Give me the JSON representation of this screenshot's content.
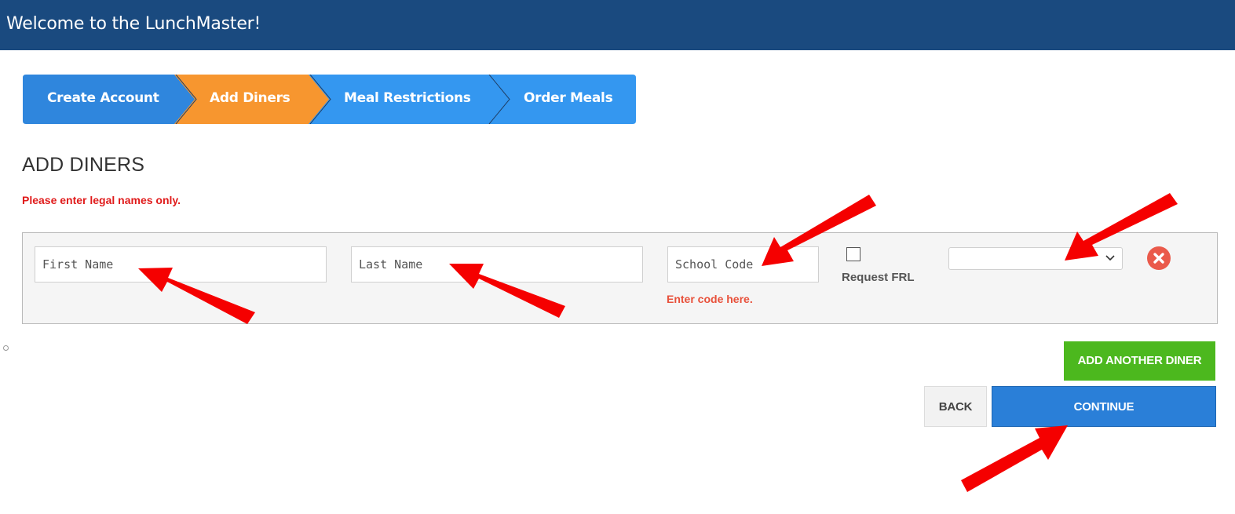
{
  "header": {
    "title": "Welcome to the LunchMaster!"
  },
  "steps": [
    {
      "label": "Create Account",
      "state": "complete"
    },
    {
      "label": "Add Diners",
      "state": "active"
    },
    {
      "label": "Meal Restrictions",
      "state": "upcoming"
    },
    {
      "label": "Order Meals",
      "state": "upcoming"
    }
  ],
  "colors": {
    "header": "#1a4a7f",
    "step_complete": "#2f86dd",
    "step_active": "#f7962f",
    "step_upcoming": "#3497f0",
    "warning": "#e01b1b",
    "add_button": "#4cb81e",
    "continue_button": "#2a7fd8",
    "annotation_arrow": "#f50000"
  },
  "main": {
    "heading": "ADD DINERS",
    "notice": "Please enter legal names only."
  },
  "diner_form": {
    "first_name": {
      "value": "",
      "placeholder": "First Name"
    },
    "last_name": {
      "value": "",
      "placeholder": "Last Name"
    },
    "school_code": {
      "value": "",
      "placeholder": "School Code",
      "hint": "Enter code here."
    },
    "request_frl": {
      "label": "Request FRL",
      "checked": false
    },
    "select": {
      "value": ""
    },
    "remove_icon": "close-circle-icon"
  },
  "actions": {
    "add_another": "ADD ANOTHER DINER",
    "back": "BACK",
    "continue": "CONTINUE"
  }
}
